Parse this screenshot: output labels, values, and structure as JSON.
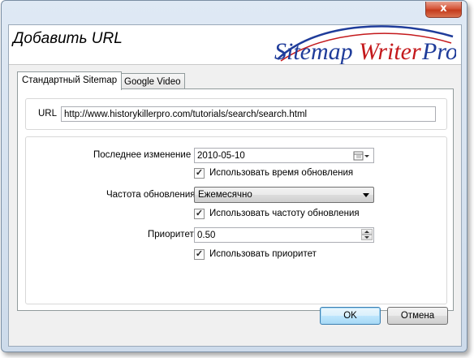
{
  "window": {
    "close_glyph": "x"
  },
  "dialog": {
    "title": "Добавить URL"
  },
  "logo": {
    "part1": "Sitemap",
    "part2": "Writer",
    "part3": "Pro"
  },
  "tabs": [
    {
      "label": "Стандартный Sitemap",
      "active": true
    },
    {
      "label": "Google Video",
      "active": false
    }
  ],
  "url": {
    "label": "URL",
    "value": "http://www.historykillerpro.com/tutorials/search/search.html"
  },
  "last_modified": {
    "label": "Последнее изменение",
    "value": "2010-05-10",
    "icon": "calendar-icon",
    "checkbox_label": "Использовать время обновления",
    "checked": true
  },
  "change_freq": {
    "label": "Частота обновления",
    "value": "Ежемесячно",
    "checkbox_label": "Использовать частоту обновления",
    "checked": true
  },
  "priority": {
    "label": "Приоритет",
    "value": "0.50",
    "checkbox_label": "Использовать приоритет",
    "checked": true
  },
  "buttons": {
    "ok": "OK",
    "cancel": "Отмена"
  },
  "colors": {
    "logo_blue": "#1f3c9a",
    "logo_red": "#c4191c"
  }
}
